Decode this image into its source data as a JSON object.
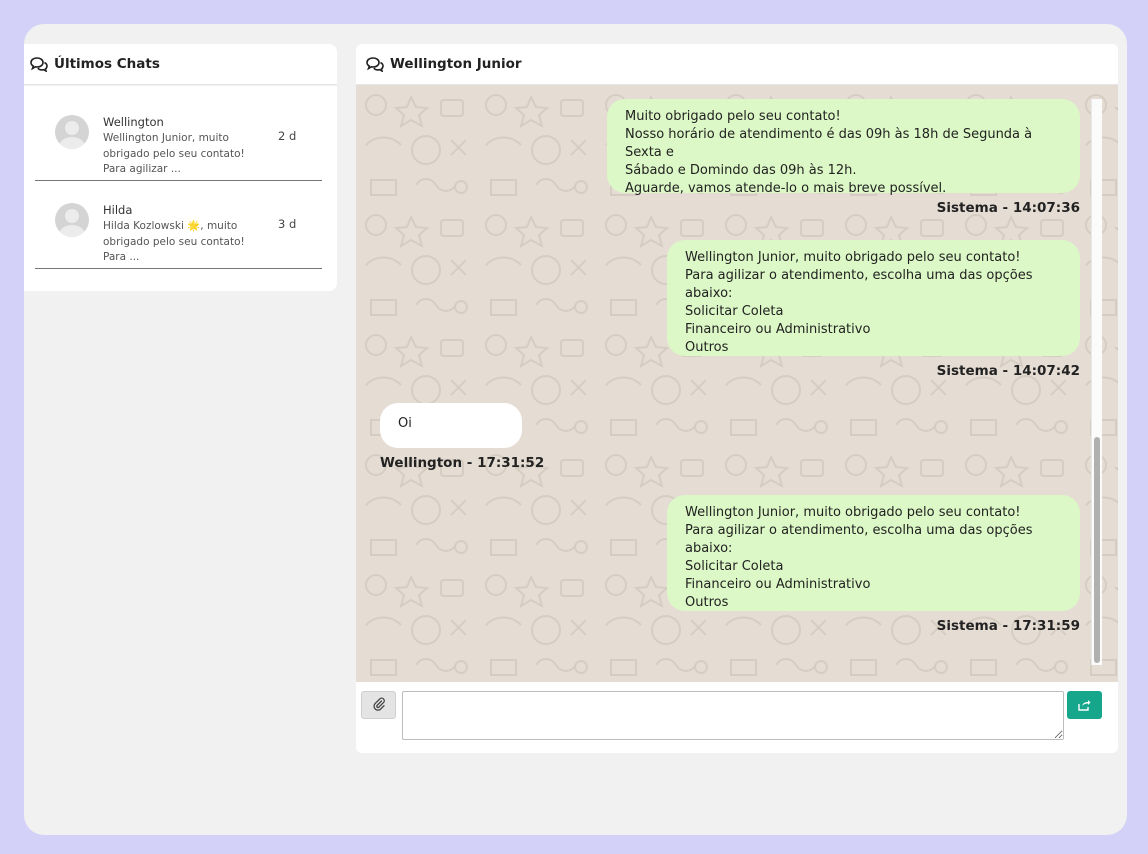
{
  "left_panel": {
    "title": "Últimos Chats",
    "icon": "chat-bubbles-icon",
    "chats": [
      {
        "name": "Wellington",
        "preview": "Wellington Junior, muito\nobrigado pelo seu contato!\nPara agilizar ...",
        "age": "2 d"
      },
      {
        "name": "Hilda",
        "preview": "Hilda Kozlowski 🌟, muito\nobrigado pelo seu contato!\nPara ...",
        "age": "3 d"
      }
    ]
  },
  "conversation": {
    "title": "Wellington Junior",
    "icon": "chat-bubbles-icon",
    "messages": [
      {
        "direction": "out",
        "text": "Muito obrigado pelo seu contato!\nNosso horário de atendimento é das 09h às 18h de Segunda à Sexta e\nSábado e Domindo das 09h às 12h.\nAguarde, vamos atende-lo o mais breve possível.",
        "meta": "Sistema - 14:07:36"
      },
      {
        "direction": "out",
        "text": "Wellington Junior, muito obrigado pelo seu contato!\nPara agilizar o atendimento, escolha uma das opções abaixo:\nSolicitar Coleta\nFinanceiro ou Administrativo\nOutros",
        "meta": "Sistema - 14:07:42"
      },
      {
        "direction": "in",
        "text": "Oi",
        "meta": "Wellington - 17:31:52"
      },
      {
        "direction": "out",
        "text": "Wellington Junior, muito obrigado pelo seu contato!\nPara agilizar o atendimento, escolha uma das opções abaixo:\nSolicitar Coleta\nFinanceiro ou Administrativo\nOutros",
        "meta": "Sistema - 17:31:59"
      }
    ]
  },
  "composer": {
    "attach_icon": "paperclip-icon",
    "send_icon": "share-icon",
    "input_value": ""
  },
  "colors": {
    "page_background": "#d3d1f7",
    "outgoing_bubble": "#dcf8c6",
    "incoming_bubble": "#ffffff",
    "chat_wallpaper": "#e5ddd4",
    "send_button": "#16a68b"
  }
}
